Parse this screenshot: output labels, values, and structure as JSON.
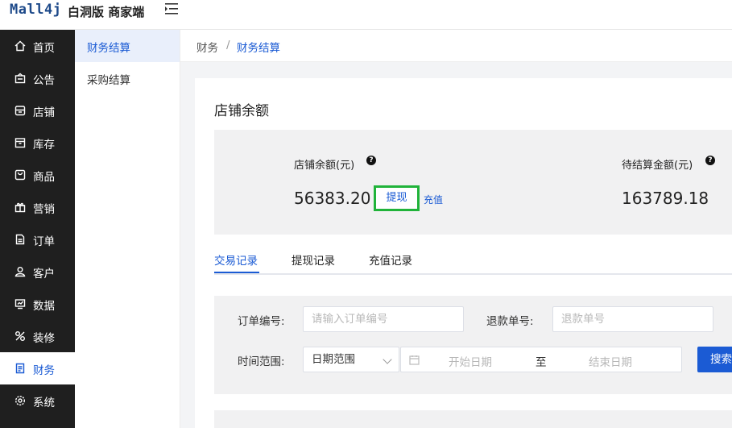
{
  "header": {
    "logo": "Mall4j",
    "app_name": "白洞版 商家端"
  },
  "sidebar": {
    "items": [
      {
        "label": "首页",
        "icon": "home-icon"
      },
      {
        "label": "公告",
        "icon": "notice-icon"
      },
      {
        "label": "店铺",
        "icon": "shop-icon"
      },
      {
        "label": "库存",
        "icon": "inventory-icon"
      },
      {
        "label": "商品",
        "icon": "product-icon"
      },
      {
        "label": "营销",
        "icon": "gift-icon"
      },
      {
        "label": "订单",
        "icon": "order-icon"
      },
      {
        "label": "客户",
        "icon": "customer-icon"
      },
      {
        "label": "数据",
        "icon": "data-icon"
      },
      {
        "label": "装修",
        "icon": "decorate-icon"
      },
      {
        "label": "财务",
        "icon": "finance-icon"
      },
      {
        "label": "系统",
        "icon": "gear-icon"
      }
    ],
    "active_index": 10
  },
  "subnav": {
    "items": [
      {
        "label": "财务结算"
      },
      {
        "label": "采购结算"
      }
    ]
  },
  "breadcrumb": {
    "parent": "财务",
    "separator": "/",
    "current": "财务结算"
  },
  "card": {
    "title": "店铺余额",
    "balance_label": "店铺余额(元)",
    "balance_value": "56383.20",
    "withdraw_label": "提现",
    "recharge_label": "充值",
    "pending_label": "待结算金额(元)",
    "pending_value": "163789.18",
    "help_glyph": "?"
  },
  "tabs": [
    {
      "label": "交易记录",
      "active": true
    },
    {
      "label": "提现记录",
      "active": false
    },
    {
      "label": "充值记录",
      "active": false
    }
  ],
  "filter": {
    "order_no_label": "订单编号:",
    "order_no_placeholder": "请输入订单编号",
    "refund_no_label": "退款单号:",
    "refund_no_placeholder": "退款单号",
    "time_range_label": "时间范围:",
    "time_range_select": "日期范围",
    "start_date_placeholder": "开始日期",
    "range_separator": "至",
    "end_date_placeholder": "结束日期",
    "search_label": "搜索"
  },
  "colors": {
    "primary": "#1b5bd4",
    "sidebar_bg": "#1f1f1f",
    "highlight_border": "#20b33a"
  }
}
